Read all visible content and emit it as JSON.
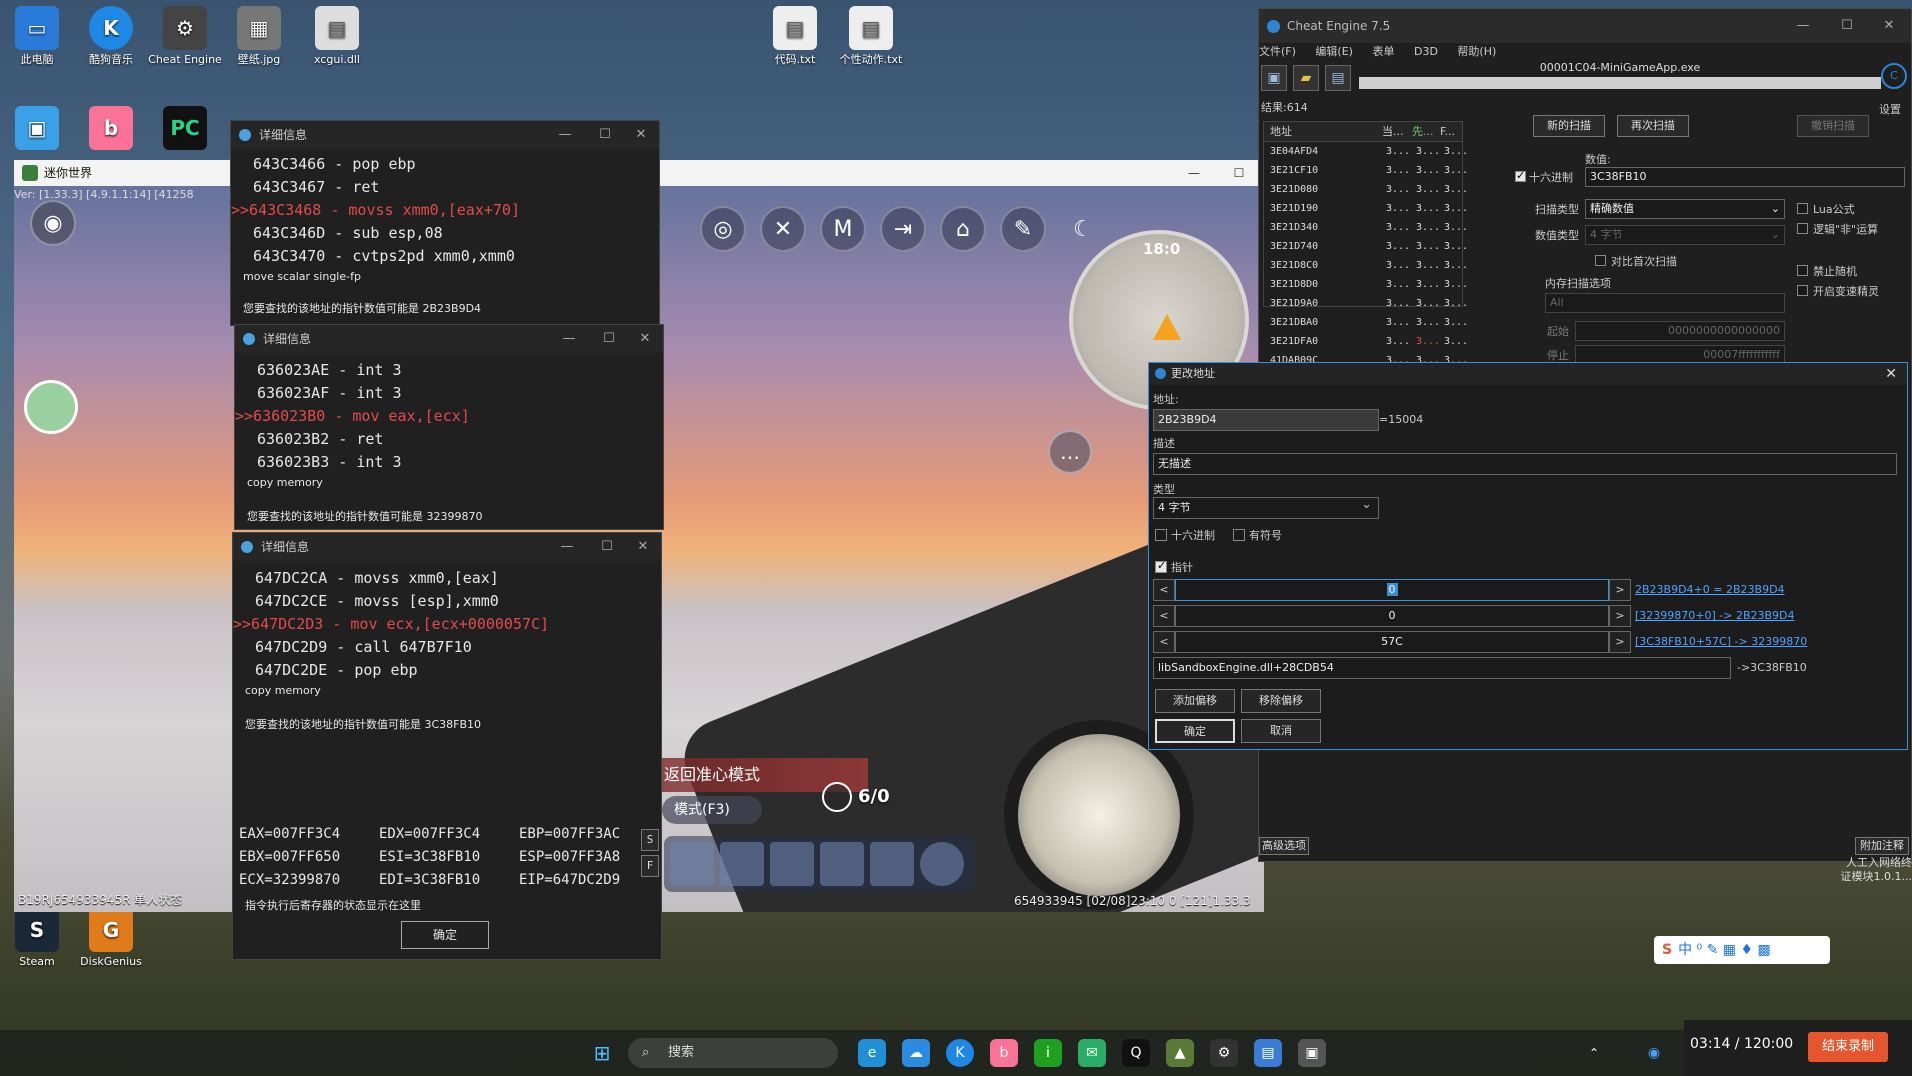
{
  "desktop": {
    "icons": [
      {
        "name": "此电脑",
        "color": "#2a7bd8",
        "glyph": "▭"
      },
      {
        "name": "酷狗音乐",
        "color": "#1e88e5",
        "glyph": "K"
      },
      {
        "name": "Cheat Engine",
        "color": "#444444",
        "glyph": "⚙"
      },
      {
        "name": "壁纸.jpg",
        "color": "#777777",
        "glyph": "▦"
      },
      {
        "name": "xcgui.dll",
        "color": "#dddddd",
        "glyph": "▤"
      },
      {
        "name": "代码.txt",
        "color": "#eeeeee",
        "glyph": "▤"
      },
      {
        "name": "个性动作.txt",
        "color": "#eeeeee",
        "glyph": "▤"
      }
    ],
    "left_icons": [
      {
        "name": "Steam",
        "color": "#1b2838",
        "glyph": "S"
      },
      {
        "name": "DiskGenius",
        "color": "#e07b1c",
        "glyph": "G"
      }
    ],
    "corner_note": [
      "人工入网络终",
      "证模块1.0.1..."
    ]
  },
  "game": {
    "title": "迷你世界",
    "version": "Ver: [1.33.3] [4.9.1.1:14] [41258",
    "minimap_time": "18:0",
    "mode_banner": "返回准心模式",
    "mode_pill": "模式(F3)",
    "ammo": "6/0",
    "footer_left": "B19RJ654933945R 单人状态",
    "footer_right": "654933945   [02/08]23:10 0  [121]1.33.3"
  },
  "detail_windows": [
    {
      "title": "详细信息",
      "lines": [
        "643C3466 - pop ebp",
        "643C3467 - ret",
        ">>643C3468 - movss xmm0,[eax+70]",
        "643C346D - sub esp,08",
        "643C3470 - cvtps2pd xmm0,xmm0"
      ],
      "current_index": 2,
      "note": "move scalar single-fp",
      "pointer_text": "您要查找的该地址的指针数值可能是 2B23B9D4"
    },
    {
      "title": "详细信息",
      "lines": [
        "636023AE - int 3",
        "636023AF - int 3",
        ">>636023B0 - mov eax,[ecx]",
        "636023B2 - ret",
        "636023B3 - int 3"
      ],
      "current_index": 2,
      "note": "copy memory",
      "pointer_text": "您要查找的该地址的指针数值可能是 32399870"
    },
    {
      "title": "详细信息",
      "lines": [
        "647DC2CA - movss xmm0,[eax]",
        "647DC2CE - movss [esp],xmm0",
        ">>647DC2D3 - mov ecx,[ecx+0000057C]",
        "647DC2D9 - call 647B7F10",
        "647DC2DE - pop ebp"
      ],
      "current_index": 2,
      "note": "copy memory",
      "pointer_text": "您要查找的该地址的指针数值可能是 3C38FB10",
      "registers": [
        [
          "EAX=007FF3C4",
          "EDX=007FF3C4",
          "EBP=007FF3AC"
        ],
        [
          "EBX=007FF650",
          "ESI=3C38FB10",
          "ESP=007FF3A8"
        ],
        [
          "ECX=32399870",
          "EDI=3C38FB10",
          "EIP=647DC2D9"
        ]
      ],
      "side_buttons": [
        "S",
        "F"
      ],
      "status": "指令执行后寄存器的状态显示在这里",
      "ok_label": "确定"
    }
  ],
  "cheat_engine": {
    "title": "Cheat Engine 7.5",
    "menu": [
      "文件(F)",
      "编辑(E)",
      "表单",
      "D3D",
      "帮助(H)"
    ],
    "process": "00001C04-MiniGameApp.exe",
    "settings_label": "设置",
    "results": "结果:614",
    "columns": [
      "地址",
      "当...",
      "先...",
      "F..."
    ],
    "rows": [
      {
        "addr": "3E04AFD4",
        "a": "3...",
        "b": "3...",
        "c": "3...",
        "red": false
      },
      {
        "addr": "3E21CF10",
        "a": "3...",
        "b": "3...",
        "c": "3...",
        "red": false
      },
      {
        "addr": "3E21D080",
        "a": "3...",
        "b": "3...",
        "c": "3...",
        "red": false
      },
      {
        "addr": "3E21D190",
        "a": "3...",
        "b": "3...",
        "c": "3...",
        "red": false
      },
      {
        "addr": "3E21D340",
        "a": "3...",
        "b": "3...",
        "c": "3...",
        "red": false
      },
      {
        "addr": "3E21D740",
        "a": "3...",
        "b": "3...",
        "c": "3...",
        "red": false
      },
      {
        "addr": "3E21D8C0",
        "a": "3...",
        "b": "3...",
        "c": "3...",
        "red": false
      },
      {
        "addr": "3E21D8D0",
        "a": "3...",
        "b": "3...",
        "c": "3...",
        "red": false
      },
      {
        "addr": "3E21D9A0",
        "a": "3...",
        "b": "3...",
        "c": "3...",
        "red": false
      },
      {
        "addr": "3E21DBA0",
        "a": "3...",
        "b": "3...",
        "c": "3...",
        "red": false
      },
      {
        "addr": "3E21DFA0",
        "a": "3...",
        "b": "3...",
        "c": "3...",
        "red": true
      },
      {
        "addr": "41DAB09C",
        "a": "3...",
        "b": "3...",
        "c": "3...",
        "red": false
      }
    ],
    "new_scan": "新的扫描",
    "next_scan": "再次扫描",
    "undo_scan": "撤销扫描",
    "value_label": "数值:",
    "hex_label": "十六进制",
    "value": "3C38FB10",
    "scan_type_label": "扫描类型",
    "scan_type": "精确数值",
    "value_type_label": "数值类型",
    "value_type": "4 字节",
    "compare_first": "对比首次扫描",
    "lua": "Lua公式",
    "not_op": "逻辑\"非\"运算",
    "no_random": "禁止随机",
    "speedhack": "开启变速精灵",
    "mem_scan_options": "内存扫描选项",
    "mem_all": "All",
    "start_label": "起始",
    "start_value": "0000000000000000",
    "stop_label": "停止",
    "stop_value": "00007fffffffffff",
    "advanced": "高级选项",
    "add_comment": "附加注释"
  },
  "change_address": {
    "title": "更改地址",
    "address_label": "地址:",
    "address": "2B23B9D4",
    "address_value": "=15004",
    "desc_label": "描述",
    "desc": "无描述",
    "type_label": "类型",
    "type": "4 字节",
    "hex": "十六进制",
    "signed": "有符号",
    "pointer": "指针",
    "offsets": [
      {
        "value": "0",
        "link": "2B23B9D4+0 = 2B23B9D4",
        "selected": true
      },
      {
        "value": "0",
        "link": "[32399870+0] -> 2B23B9D4",
        "selected": false
      },
      {
        "value": "57C",
        "link": "[3C38FB10+57C] -> 32399870",
        "selected": false
      }
    ],
    "base": "libSandboxEngine.dll+28CDB54",
    "base_result": "->3C38FB10",
    "add_offset": "添加偏移",
    "remove_offset": "移除偏移",
    "ok": "确定",
    "cancel": "取消"
  },
  "taskbar": {
    "search": "搜索",
    "recording_time": "03:14 / 120:00",
    "stop_recording": "结束录制",
    "ime": "中 ⁰ ✎ ▦ ♦ ▩"
  }
}
